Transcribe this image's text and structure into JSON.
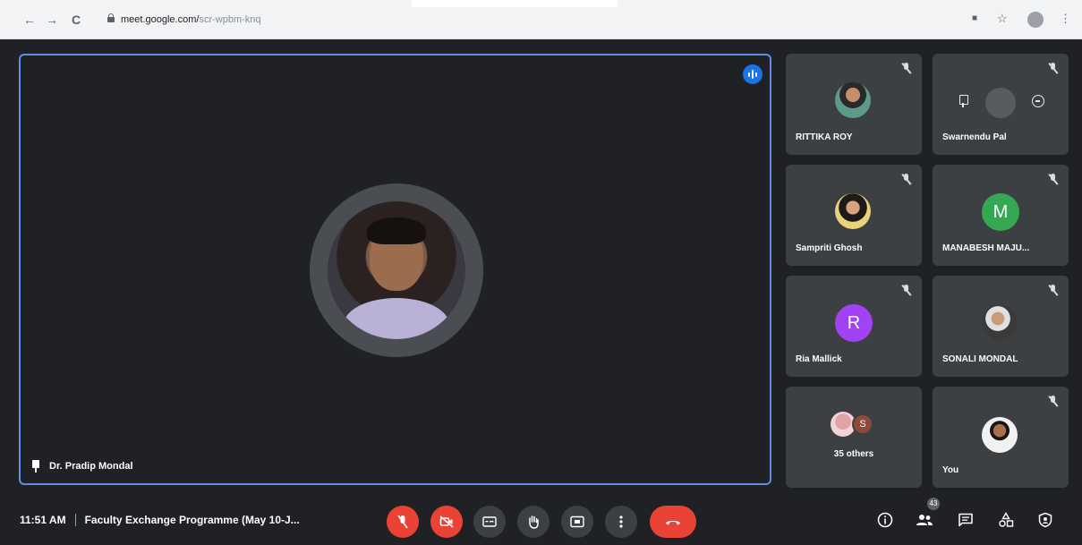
{
  "browser": {
    "url_host": "meet.google.com/",
    "url_path": "scr-wpbm-knq",
    "back": "←",
    "forward": "→",
    "reload": "C",
    "menu": "⋮",
    "star": "☆",
    "camera": "■"
  },
  "main": {
    "presenter_name": "Dr. Pradip Mondal"
  },
  "participants": [
    {
      "name": "RITTIKA ROY",
      "avatar": "photo"
    },
    {
      "name": "Swarnendu Pal",
      "avatar": "photo-hover"
    },
    {
      "name": "Sampriti Ghosh",
      "avatar": "photo"
    },
    {
      "name": "MANABESH MAJU...",
      "avatar": "letter",
      "letter": "M",
      "color": "#34a853"
    },
    {
      "name": "Ria Mallick",
      "avatar": "letter",
      "letter": "R",
      "color": "#a142f4"
    },
    {
      "name": "SONALI MONDAL",
      "avatar": "photo"
    },
    {
      "name": "35 others",
      "avatar": "group",
      "letter": "S",
      "color": "#8d4a3a"
    },
    {
      "name": "You",
      "avatar": "photo"
    }
  ],
  "bottom": {
    "time": "11:51 AM",
    "meeting_title": "Faculty Exchange Programme (May 10-J...",
    "participant_count": "43"
  },
  "colors": {
    "accent": "#1a73e8",
    "danger": "#ea4335",
    "tile": "#3c4043",
    "background": "#202124"
  }
}
